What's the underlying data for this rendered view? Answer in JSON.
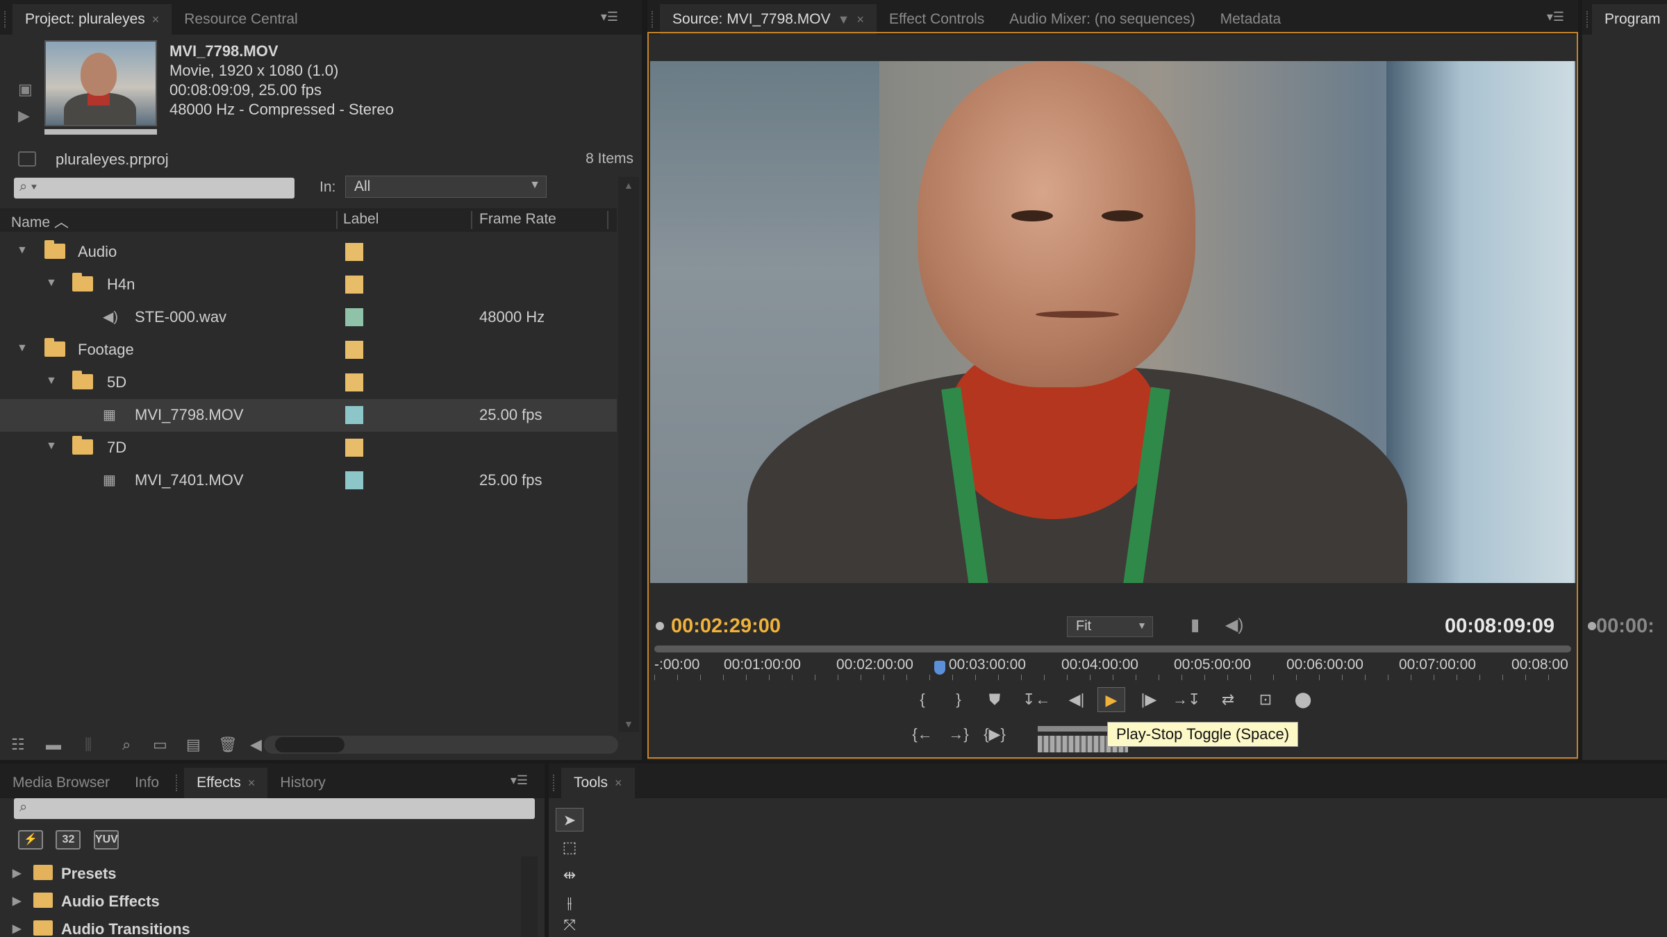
{
  "project_panel": {
    "tabs": [
      {
        "label": "Project: pluraleyes",
        "active": true
      },
      {
        "label": "Resource Central",
        "active": false
      }
    ],
    "clip_info": {
      "filename": "MVI_7798.MOV",
      "line1": "Movie, 1920 x 1080 (1.0)",
      "line2": "00:08:09:09, 25.00 fps",
      "line3": "48000 Hz - Compressed - Stereo"
    },
    "project_file": "pluraleyes.prproj",
    "item_count": "8 Items",
    "search_placeholder": "",
    "in_label": "In:",
    "in_value": "All",
    "columns": [
      "Name",
      "Label",
      "Frame Rate"
    ],
    "items": [
      {
        "name": "Audio",
        "type": "folder",
        "depth": 0,
        "expanded": true,
        "label_color": "#e8bd6a",
        "rate": ""
      },
      {
        "name": "H4n",
        "type": "folder",
        "depth": 1,
        "expanded": true,
        "label_color": "#e8bd6a",
        "rate": ""
      },
      {
        "name": "STE-000.wav",
        "type": "audio",
        "depth": 2,
        "label_color": "#8fc2a8",
        "rate": "48000 Hz"
      },
      {
        "name": "Footage",
        "type": "folder",
        "depth": 0,
        "expanded": true,
        "label_color": "#e8bd6a",
        "rate": ""
      },
      {
        "name": "5D",
        "type": "folder",
        "depth": 1,
        "expanded": true,
        "label_color": "#e8bd6a",
        "rate": ""
      },
      {
        "name": "MVI_7798.MOV",
        "type": "video",
        "depth": 2,
        "label_color": "#8cc6c8",
        "rate": "25.00 fps",
        "selected": true
      },
      {
        "name": "7D",
        "type": "folder",
        "depth": 1,
        "expanded": true,
        "label_color": "#e8bd6a",
        "rate": ""
      },
      {
        "name": "MVI_7401.MOV",
        "type": "video",
        "depth": 2,
        "label_color": "#8cc6c8",
        "rate": "25.00 fps"
      }
    ]
  },
  "source_panel": {
    "tabs": [
      {
        "label": "Source: MVI_7798.MOV",
        "active": true
      },
      {
        "label": "Effect Controls",
        "active": false
      },
      {
        "label": "Audio Mixer: (no sequences)",
        "active": false
      },
      {
        "label": "Metadata",
        "active": false
      }
    ],
    "current_time": "00:02:29:00",
    "duration": "00:08:09:09",
    "zoom": "Fit",
    "playhead_fraction": 0.305,
    "ruler_labels": [
      "-:00:00",
      "00:01:00:00",
      "00:02:00:00",
      "00:03:00:00",
      "00:04:00:00",
      "00:05:00:00",
      "00:06:00:00",
      "00:07:00:00",
      "00:08:00"
    ],
    "tooltip": "Play-Stop Toggle (Space)"
  },
  "program_panel": {
    "tab": "Program",
    "time": "00:00:"
  },
  "effects_panel": {
    "tabs": [
      {
        "label": "Media Browser",
        "active": false
      },
      {
        "label": "Info",
        "active": false
      },
      {
        "label": "Effects",
        "active": true
      },
      {
        "label": "History",
        "active": false
      }
    ],
    "badges": [
      "32",
      "YUV"
    ],
    "items": [
      "Presets",
      "Audio Effects",
      "Audio Transitions"
    ]
  },
  "tools_panel": {
    "tab": "Tools"
  },
  "colors": {
    "accent": "#f0b23b",
    "frame": "#c7862a",
    "playhead": "#5b8fd9"
  }
}
